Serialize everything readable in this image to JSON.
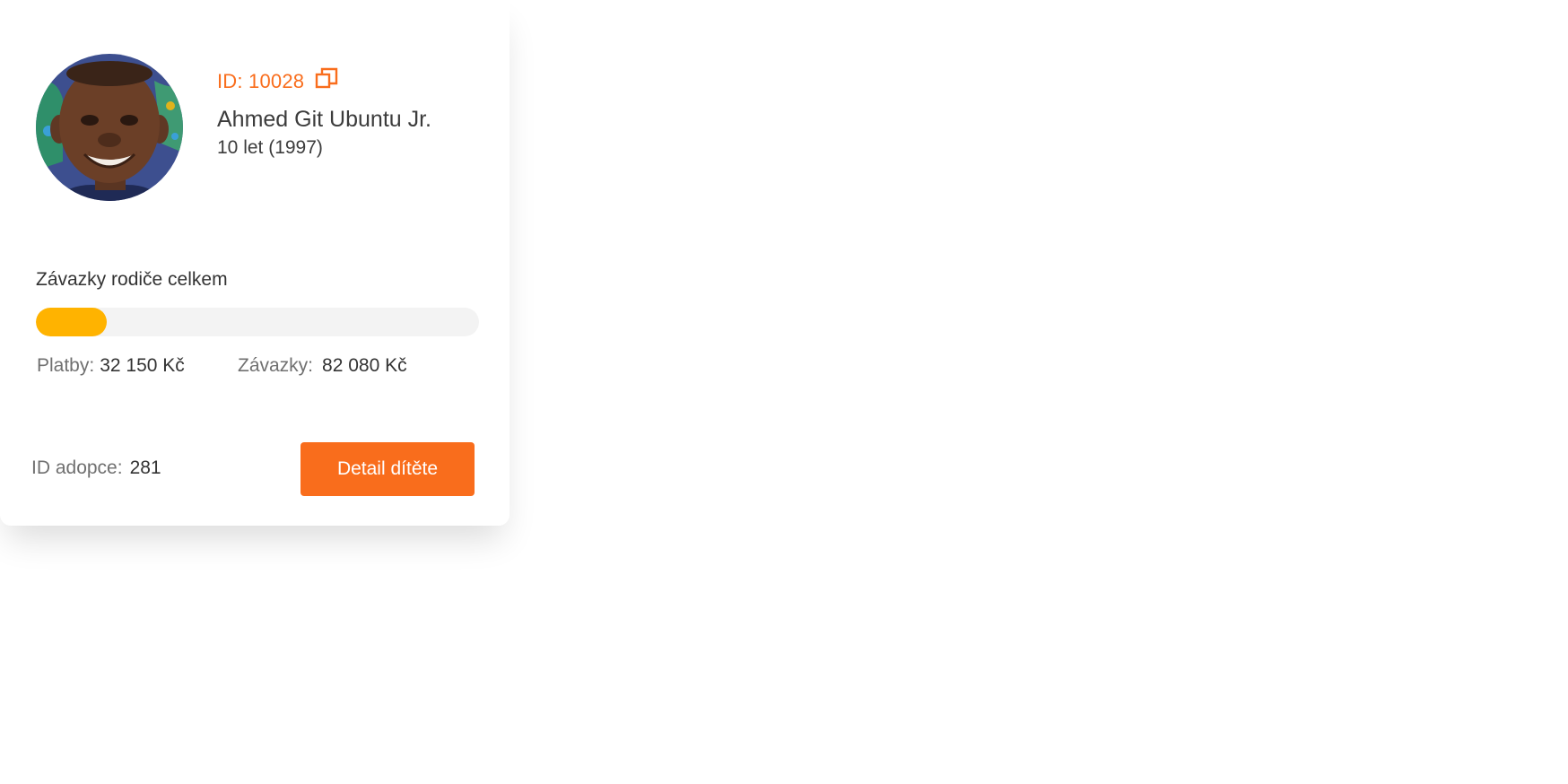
{
  "child": {
    "id_label": "ID: 10028",
    "name": "Ahmed Git Ubuntu Jr.",
    "age": "10 let (1997)",
    "copy_icon": "copy-icon",
    "avatar_icon": "child-photo"
  },
  "commitments": {
    "title": "Závazky rodiče celkem",
    "progress_fraction": 0.16,
    "payments_label": "Platby:",
    "payments_value": "32 150 Kč",
    "commitments_label": "Závazky:",
    "commitments_value": "82 080 Kč"
  },
  "adoption": {
    "label": "ID adopce:",
    "value": "281"
  },
  "actions": {
    "detail_label": "Detail dítěte"
  },
  "colors": {
    "accent": "#f96d1c",
    "progress": "#ffb300",
    "track": "#f3f3f3",
    "text": "#333333",
    "muted": "#707070"
  }
}
